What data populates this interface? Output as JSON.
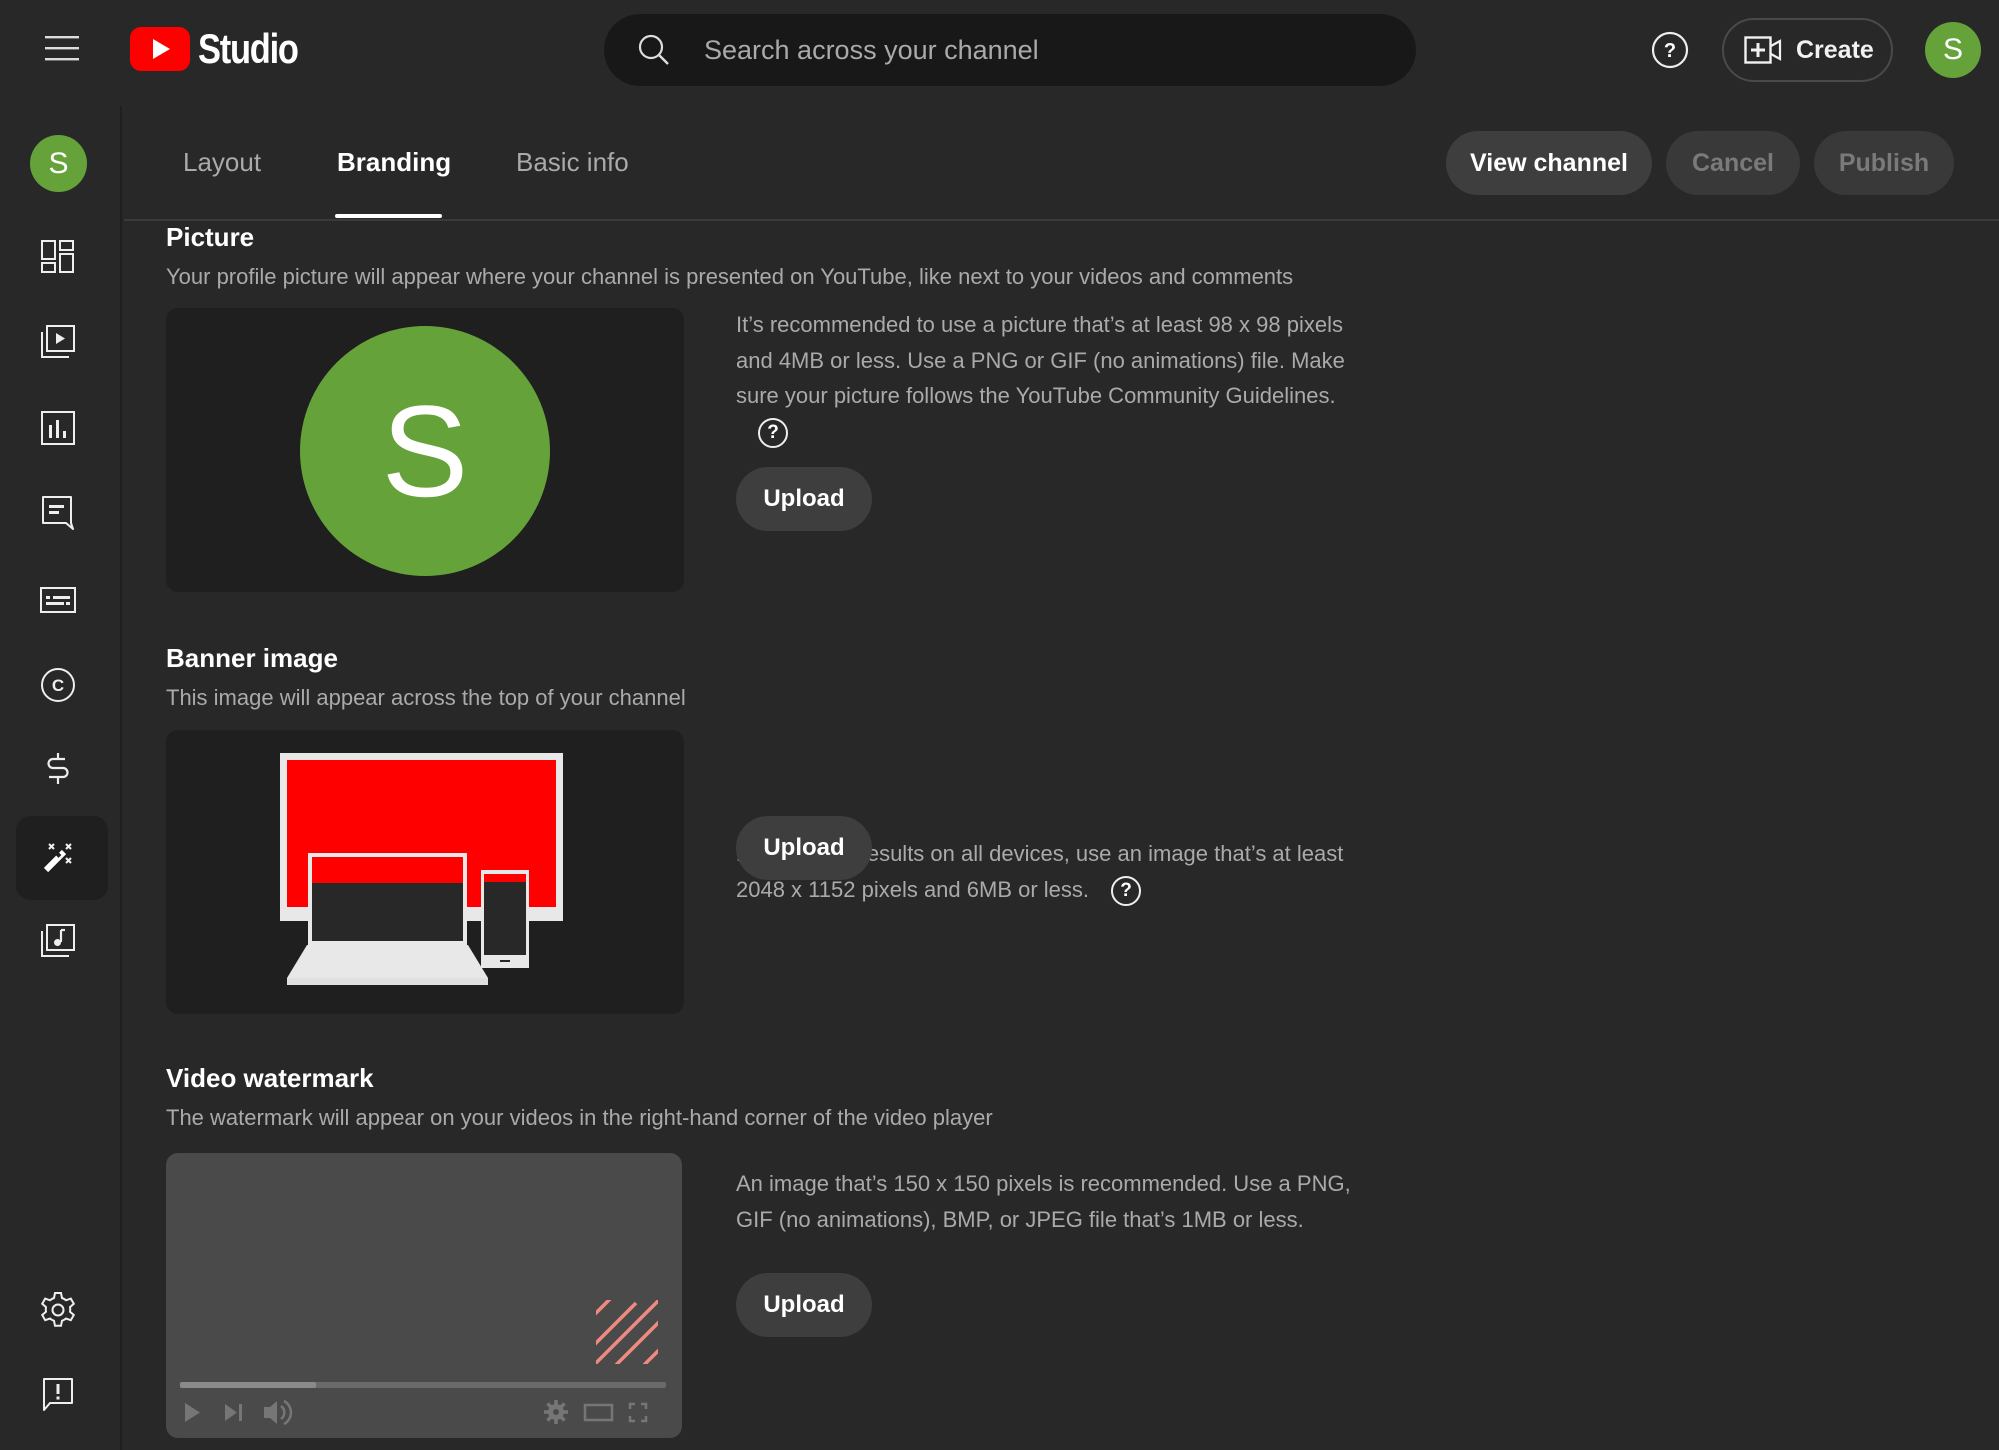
{
  "app": {
    "logo_text": "Studio",
    "brand_color": "#ff0000",
    "avatar_letter": "S",
    "avatar_color": "#65a33a"
  },
  "topbar": {
    "menu_icon": "hamburger-menu-icon",
    "search_placeholder": "Search across your channel",
    "help_icon": "help-circle-icon",
    "create_label": "Create",
    "create_icon": "video-add-icon"
  },
  "sidebar": {
    "items": [
      {
        "name": "dashboard",
        "icon": "dashboard-icon"
      },
      {
        "name": "content",
        "icon": "video-library-icon"
      },
      {
        "name": "analytics",
        "icon": "analytics-icon"
      },
      {
        "name": "comments",
        "icon": "comments-icon"
      },
      {
        "name": "subtitles",
        "icon": "subtitles-icon"
      },
      {
        "name": "copyright",
        "icon": "copyright-icon"
      },
      {
        "name": "earn",
        "icon": "dollar-icon"
      },
      {
        "name": "customization",
        "icon": "magic-wand-icon",
        "active": true
      },
      {
        "name": "audio-library",
        "icon": "audio-library-icon"
      }
    ],
    "bottom": [
      {
        "name": "settings",
        "icon": "gear-icon"
      },
      {
        "name": "send-feedback",
        "icon": "feedback-icon"
      }
    ]
  },
  "tabs": [
    {
      "label": "Layout",
      "active": false
    },
    {
      "label": "Branding",
      "active": true
    },
    {
      "label": "Basic info",
      "active": false
    }
  ],
  "actions": {
    "view_channel": "View channel",
    "cancel": "Cancel",
    "publish": "Publish"
  },
  "sections": {
    "picture": {
      "title": "Picture",
      "description": "Your profile picture will appear where your channel is presented on YouTube, like next to your videos and comments",
      "info": "It’s recommended to use a picture that’s at least 98 x 98 pixels and 4MB or less. Use a PNG or GIF (no animations) file. Make sure your picture follows the YouTube Community Guidelines.",
      "upload_label": "Upload",
      "preview_letter": "S"
    },
    "banner": {
      "title": "Banner image",
      "description": "This image will appear across the top of your channel",
      "info": "For the best results on all devices, use an image that’s at least 2048 x 1152 pixels and 6MB or less.",
      "upload_label": "Upload"
    },
    "watermark": {
      "title": "Video watermark",
      "description": "The watermark will appear on your videos in the right-hand corner of the video player",
      "info": "An image that’s 150 x 150 pixels is recommended. Use a PNG, GIF (no animations), BMP, or JPEG file that’s 1MB or less.",
      "upload_label": "Upload",
      "player_progress": 0.28
    }
  },
  "help_glyph": "?"
}
